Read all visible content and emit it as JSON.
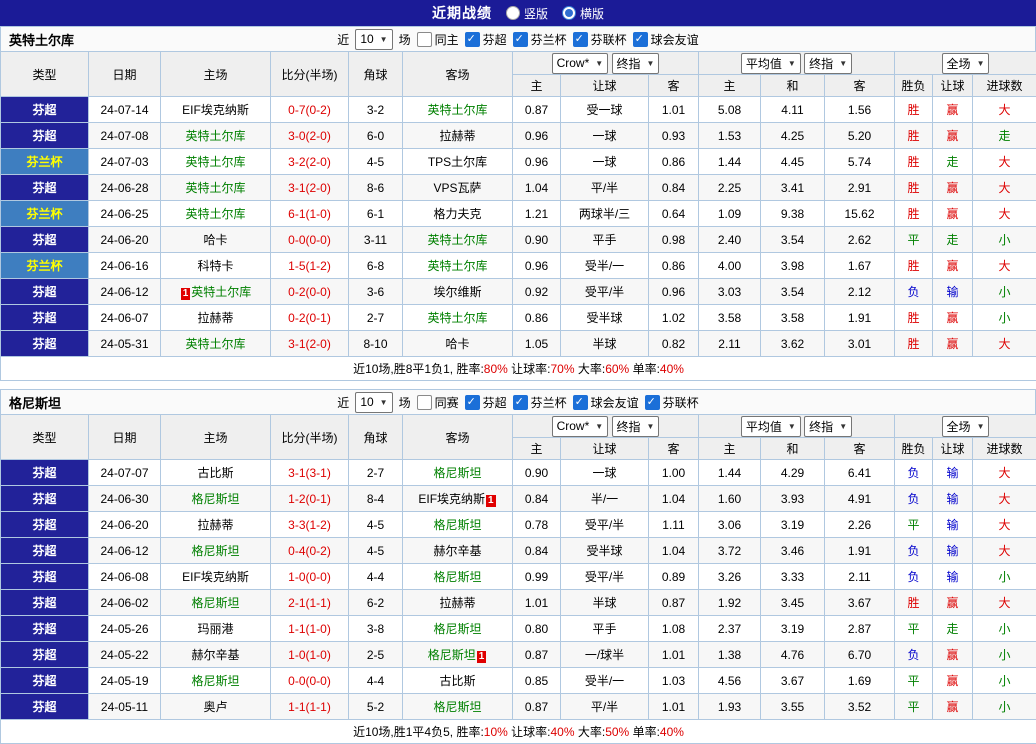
{
  "topbar": {
    "title": "近期战绩",
    "radios": [
      {
        "label": "竖版",
        "checked": false
      },
      {
        "label": "横版",
        "checked": true
      }
    ]
  },
  "shared": {
    "near": "近",
    "unit": "场",
    "card_badge": "1"
  },
  "table_headers": {
    "type": "类型",
    "date": "日期",
    "home": "主场",
    "score": "比分(半场)",
    "corner": "角球",
    "away": "客场",
    "ah_dd1": "Crow*",
    "ah_dd2": "终指",
    "ah_home": "主",
    "ah_line": "让球",
    "ah_away": "客",
    "eu_dd1": "平均值",
    "eu_dd2": "终指",
    "eu_home": "主",
    "eu_draw": "和",
    "eu_away": "客",
    "res_dd": "全场",
    "res_wl": "胜负",
    "res_hcp": "让球",
    "res_goal": "进球数"
  },
  "colors": {
    "win_red": "#dd0000",
    "draw_green": "#008000",
    "loss_blue": "#0000cc",
    "navy_bar": "#1b1b97",
    "league_super_bg": "#222299",
    "league_cup_bg": "#3e7ec0"
  },
  "tables": [
    {
      "team": "英特土尔库",
      "filter": {
        "count": "10",
        "same": "同主",
        "same_checked": false,
        "leagues": [
          {
            "label": "芬超",
            "checked": true
          },
          {
            "label": "芬兰杯",
            "checked": true
          },
          {
            "label": "芬联杯",
            "checked": true
          },
          {
            "label": "球会友谊",
            "checked": true
          }
        ]
      },
      "rows": [
        {
          "lg": "芬超",
          "ls": "super",
          "date": "24-07-14",
          "home": {
            "n": "EIF埃克纳斯",
            "g": false
          },
          "score": "0-7(0-2)",
          "corner": "3-2",
          "away": {
            "n": "英特土尔库",
            "g": true
          },
          "ah": [
            "0.87",
            "受一球",
            "1.01"
          ],
          "eu": [
            "5.08",
            "4.11",
            "1.56"
          ],
          "res": [
            [
              "胜",
              "r"
            ],
            [
              "赢",
              "r"
            ],
            [
              "大",
              "r"
            ]
          ]
        },
        {
          "lg": "芬超",
          "ls": "super",
          "date": "24-07-08",
          "home": {
            "n": "英特土尔库",
            "g": true
          },
          "score": "3-0(2-0)",
          "corner": "6-0",
          "away": {
            "n": "拉赫蒂",
            "g": false
          },
          "ah": [
            "0.96",
            "一球",
            "0.93"
          ],
          "eu": [
            "1.53",
            "4.25",
            "5.20"
          ],
          "res": [
            [
              "胜",
              "r"
            ],
            [
              "赢",
              "r"
            ],
            [
              "走",
              "g"
            ]
          ]
        },
        {
          "lg": "芬兰杯",
          "ls": "cup",
          "date": "24-07-03",
          "home": {
            "n": "英特土尔库",
            "g": true
          },
          "score": "3-2(2-0)",
          "corner": "4-5",
          "away": {
            "n": "TPS土尔库",
            "g": false
          },
          "ah": [
            "0.96",
            "一球",
            "0.86"
          ],
          "eu": [
            "1.44",
            "4.45",
            "5.74"
          ],
          "res": [
            [
              "胜",
              "r"
            ],
            [
              "走",
              "g"
            ],
            [
              "大",
              "r"
            ]
          ]
        },
        {
          "lg": "芬超",
          "ls": "super",
          "date": "24-06-28",
          "home": {
            "n": "英特土尔库",
            "g": true
          },
          "score": "3-1(2-0)",
          "corner": "8-6",
          "away": {
            "n": "VPS瓦萨",
            "g": false
          },
          "ah": [
            "1.04",
            "平/半",
            "0.84"
          ],
          "eu": [
            "2.25",
            "3.41",
            "2.91"
          ],
          "res": [
            [
              "胜",
              "r"
            ],
            [
              "赢",
              "r"
            ],
            [
              "大",
              "r"
            ]
          ]
        },
        {
          "lg": "芬兰杯",
          "ls": "cup",
          "date": "24-06-25",
          "home": {
            "n": "英特土尔库",
            "g": true
          },
          "score": "6-1(1-0)",
          "corner": "6-1",
          "away": {
            "n": "格力夫克",
            "g": false
          },
          "ah": [
            "1.21",
            "两球半/三",
            "0.64"
          ],
          "eu": [
            "1.09",
            "9.38",
            "15.62"
          ],
          "res": [
            [
              "胜",
              "r"
            ],
            [
              "赢",
              "r"
            ],
            [
              "大",
              "r"
            ]
          ]
        },
        {
          "lg": "芬超",
          "ls": "super",
          "date": "24-06-20",
          "home": {
            "n": "哈卡",
            "g": false
          },
          "score": "0-0(0-0)",
          "corner": "3-11",
          "away": {
            "n": "英特土尔库",
            "g": true
          },
          "ah": [
            "0.90",
            "平手",
            "0.98"
          ],
          "eu": [
            "2.40",
            "3.54",
            "2.62"
          ],
          "res": [
            [
              "平",
              "g"
            ],
            [
              "走",
              "g"
            ],
            [
              "小",
              "g"
            ]
          ]
        },
        {
          "lg": "芬兰杯",
          "ls": "cup",
          "date": "24-06-16",
          "home": {
            "n": "科特卡",
            "g": false
          },
          "score": "1-5(1-2)",
          "corner": "6-8",
          "away": {
            "n": "英特土尔库",
            "g": true
          },
          "ah": [
            "0.96",
            "受半/一",
            "0.86"
          ],
          "eu": [
            "4.00",
            "3.98",
            "1.67"
          ],
          "res": [
            [
              "胜",
              "r"
            ],
            [
              "赢",
              "r"
            ],
            [
              "大",
              "r"
            ]
          ]
        },
        {
          "lg": "芬超",
          "ls": "super",
          "date": "24-06-12",
          "home": {
            "n": "英特土尔库",
            "g": true,
            "card": "pre"
          },
          "score": "0-2(0-0)",
          "corner": "3-6",
          "away": {
            "n": "埃尔维斯",
            "g": false
          },
          "ah": [
            "0.92",
            "受平/半",
            "0.96"
          ],
          "eu": [
            "3.03",
            "3.54",
            "2.12"
          ],
          "res": [
            [
              "负",
              "b"
            ],
            [
              "输",
              "b"
            ],
            [
              "小",
              "g"
            ]
          ]
        },
        {
          "lg": "芬超",
          "ls": "super",
          "date": "24-06-07",
          "home": {
            "n": "拉赫蒂",
            "g": false
          },
          "score": "0-2(0-1)",
          "corner": "2-7",
          "away": {
            "n": "英特土尔库",
            "g": true
          },
          "ah": [
            "0.86",
            "受半球",
            "1.02"
          ],
          "eu": [
            "3.58",
            "3.58",
            "1.91"
          ],
          "res": [
            [
              "胜",
              "r"
            ],
            [
              "赢",
              "r"
            ],
            [
              "小",
              "g"
            ]
          ]
        },
        {
          "lg": "芬超",
          "ls": "super",
          "date": "24-05-31",
          "home": {
            "n": "英特土尔库",
            "g": true
          },
          "score": "3-1(2-0)",
          "corner": "8-10",
          "away": {
            "n": "哈卡",
            "g": false
          },
          "ah": [
            "1.05",
            "半球",
            "0.82"
          ],
          "eu": [
            "2.11",
            "3.62",
            "3.01"
          ],
          "res": [
            [
              "胜",
              "r"
            ],
            [
              "赢",
              "r"
            ],
            [
              "大",
              "r"
            ]
          ]
        }
      ],
      "footer": [
        [
          "近10场,胜8平1负1, ",
          "k"
        ],
        [
          "胜率:",
          "k"
        ],
        [
          "80%",
          "r"
        ],
        [
          " 让球率:",
          "k"
        ],
        [
          "70%",
          "r"
        ],
        [
          " 大率:",
          "k"
        ],
        [
          "60%",
          "r"
        ],
        [
          " 单率:",
          "k"
        ],
        [
          "40%",
          "r"
        ]
      ]
    },
    {
      "team": "格尼斯坦",
      "filter": {
        "count": "10",
        "same": "同赛",
        "same_checked": false,
        "leagues": [
          {
            "label": "芬超",
            "checked": true
          },
          {
            "label": "芬兰杯",
            "checked": true
          },
          {
            "label": "球会友谊",
            "checked": true
          },
          {
            "label": "芬联杯",
            "checked": true
          }
        ]
      },
      "rows": [
        {
          "lg": "芬超",
          "ls": "super",
          "date": "24-07-07",
          "home": {
            "n": "古比斯",
            "g": false
          },
          "score": "3-1(3-1)",
          "corner": "2-7",
          "away": {
            "n": "格尼斯坦",
            "g": true
          },
          "ah": [
            "0.90",
            "一球",
            "1.00"
          ],
          "eu": [
            "1.44",
            "4.29",
            "6.41"
          ],
          "res": [
            [
              "负",
              "b"
            ],
            [
              "输",
              "b"
            ],
            [
              "大",
              "r"
            ]
          ]
        },
        {
          "lg": "芬超",
          "ls": "super",
          "date": "24-06-30",
          "home": {
            "n": "格尼斯坦",
            "g": true
          },
          "score": "1-2(0-1)",
          "corner": "8-4",
          "away": {
            "n": "EIF埃克纳斯",
            "g": false,
            "card": "post"
          },
          "ah": [
            "0.84",
            "半/一",
            "1.04"
          ],
          "eu": [
            "1.60",
            "3.93",
            "4.91"
          ],
          "res": [
            [
              "负",
              "b"
            ],
            [
              "输",
              "b"
            ],
            [
              "大",
              "r"
            ]
          ]
        },
        {
          "lg": "芬超",
          "ls": "super",
          "date": "24-06-20",
          "home": {
            "n": "拉赫蒂",
            "g": false
          },
          "score": "3-3(1-2)",
          "corner": "4-5",
          "away": {
            "n": "格尼斯坦",
            "g": true
          },
          "ah": [
            "0.78",
            "受平/半",
            "1.11"
          ],
          "eu": [
            "3.06",
            "3.19",
            "2.26"
          ],
          "res": [
            [
              "平",
              "g"
            ],
            [
              "输",
              "b"
            ],
            [
              "大",
              "r"
            ]
          ]
        },
        {
          "lg": "芬超",
          "ls": "super",
          "date": "24-06-12",
          "home": {
            "n": "格尼斯坦",
            "g": true
          },
          "score": "0-4(0-2)",
          "corner": "4-5",
          "away": {
            "n": "赫尔辛基",
            "g": false
          },
          "ah": [
            "0.84",
            "受半球",
            "1.04"
          ],
          "eu": [
            "3.72",
            "3.46",
            "1.91"
          ],
          "res": [
            [
              "负",
              "b"
            ],
            [
              "输",
              "b"
            ],
            [
              "大",
              "r"
            ]
          ]
        },
        {
          "lg": "芬超",
          "ls": "super",
          "date": "24-06-08",
          "home": {
            "n": "EIF埃克纳斯",
            "g": false
          },
          "score": "1-0(0-0)",
          "corner": "4-4",
          "away": {
            "n": "格尼斯坦",
            "g": true
          },
          "ah": [
            "0.99",
            "受平/半",
            "0.89"
          ],
          "eu": [
            "3.26",
            "3.33",
            "2.11"
          ],
          "res": [
            [
              "负",
              "b"
            ],
            [
              "输",
              "b"
            ],
            [
              "小",
              "g"
            ]
          ]
        },
        {
          "lg": "芬超",
          "ls": "super",
          "date": "24-06-02",
          "home": {
            "n": "格尼斯坦",
            "g": true
          },
          "score": "2-1(1-1)",
          "corner": "6-2",
          "away": {
            "n": "拉赫蒂",
            "g": false
          },
          "ah": [
            "1.01",
            "半球",
            "0.87"
          ],
          "eu": [
            "1.92",
            "3.45",
            "3.67"
          ],
          "res": [
            [
              "胜",
              "r"
            ],
            [
              "赢",
              "r"
            ],
            [
              "大",
              "r"
            ]
          ]
        },
        {
          "lg": "芬超",
          "ls": "super",
          "date": "24-05-26",
          "home": {
            "n": "玛丽港",
            "g": false
          },
          "score": "1-1(1-0)",
          "corner": "3-8",
          "away": {
            "n": "格尼斯坦",
            "g": true
          },
          "ah": [
            "0.80",
            "平手",
            "1.08"
          ],
          "eu": [
            "2.37",
            "3.19",
            "2.87"
          ],
          "res": [
            [
              "平",
              "g"
            ],
            [
              "走",
              "g"
            ],
            [
              "小",
              "g"
            ]
          ]
        },
        {
          "lg": "芬超",
          "ls": "super",
          "date": "24-05-22",
          "home": {
            "n": "赫尔辛基",
            "g": false
          },
          "score": "1-0(1-0)",
          "corner": "2-5",
          "away": {
            "n": "格尼斯坦",
            "g": true,
            "card": "post"
          },
          "ah": [
            "0.87",
            "一/球半",
            "1.01"
          ],
          "eu": [
            "1.38",
            "4.76",
            "6.70"
          ],
          "res": [
            [
              "负",
              "b"
            ],
            [
              "赢",
              "r"
            ],
            [
              "小",
              "g"
            ]
          ]
        },
        {
          "lg": "芬超",
          "ls": "super",
          "date": "24-05-19",
          "home": {
            "n": "格尼斯坦",
            "g": true
          },
          "score": "0-0(0-0)",
          "corner": "4-4",
          "away": {
            "n": "古比斯",
            "g": false
          },
          "ah": [
            "0.85",
            "受半/一",
            "1.03"
          ],
          "eu": [
            "4.56",
            "3.67",
            "1.69"
          ],
          "res": [
            [
              "平",
              "g"
            ],
            [
              "赢",
              "r"
            ],
            [
              "小",
              "g"
            ]
          ]
        },
        {
          "lg": "芬超",
          "ls": "super",
          "date": "24-05-11",
          "home": {
            "n": "奥卢",
            "g": false
          },
          "score": "1-1(1-1)",
          "corner": "5-2",
          "away": {
            "n": "格尼斯坦",
            "g": true
          },
          "ah": [
            "0.87",
            "平/半",
            "1.01"
          ],
          "eu": [
            "1.93",
            "3.55",
            "3.52"
          ],
          "res": [
            [
              "平",
              "g"
            ],
            [
              "赢",
              "r"
            ],
            [
              "小",
              "g"
            ]
          ]
        }
      ],
      "footer": [
        [
          "近10场,胜1平4负5, ",
          "k"
        ],
        [
          "胜率:",
          "k"
        ],
        [
          "10%",
          "r"
        ],
        [
          " 让球率:",
          "k"
        ],
        [
          "40%",
          "r"
        ],
        [
          " 大率:",
          "k"
        ],
        [
          "50%",
          "r"
        ],
        [
          " 单率:",
          "k"
        ],
        [
          "40%",
          "r"
        ]
      ]
    }
  ]
}
